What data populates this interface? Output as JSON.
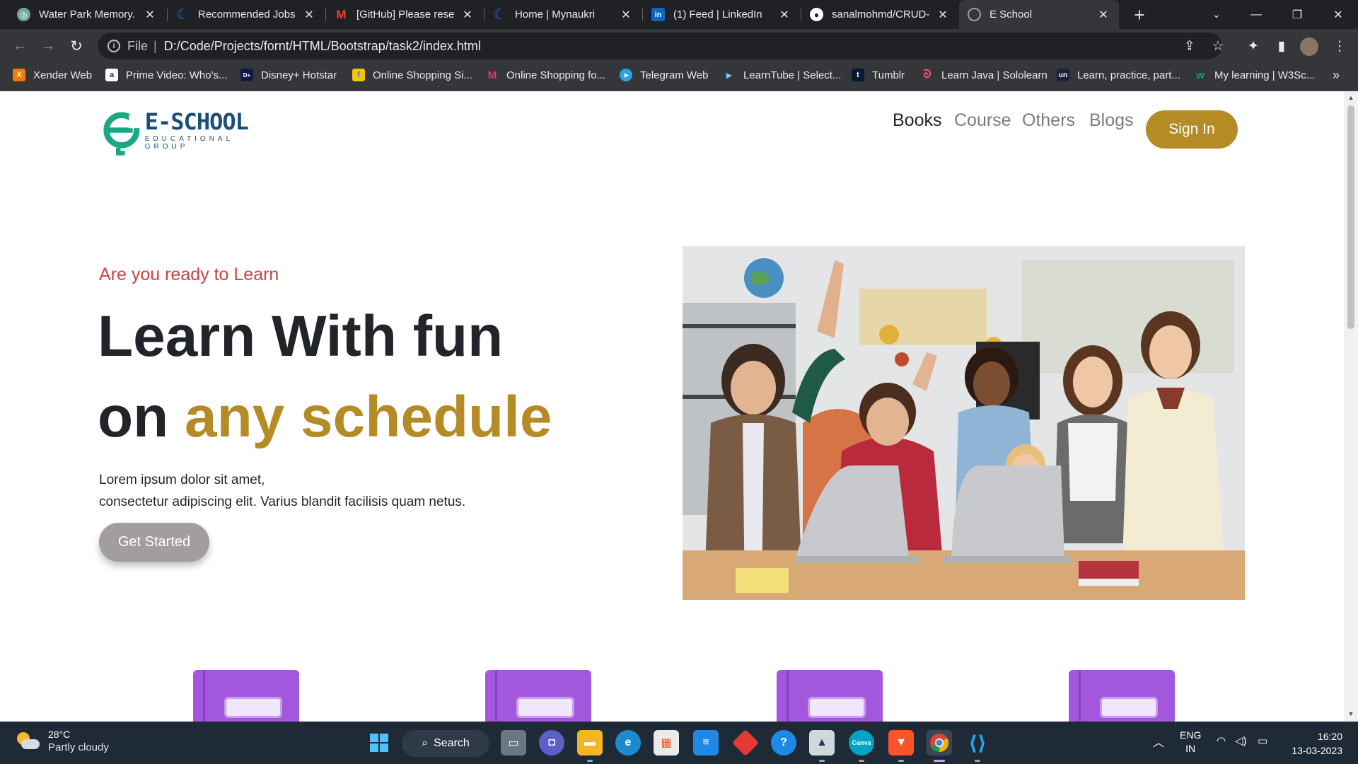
{
  "browser": {
    "tabs": [
      {
        "title": "Water Park Memory.",
        "icon": "chatgpt-icon",
        "color": "#74aa9c"
      },
      {
        "title": "Recommended Jobs |",
        "icon": "naukri-icon",
        "color": "#1d6ef0"
      },
      {
        "title": "[GitHub] Please reset",
        "icon": "gmail-icon",
        "color": "#ea4335"
      },
      {
        "title": "Home | Mynaukri",
        "icon": "naukri-icon",
        "color": "#1d6ef0"
      },
      {
        "title": "(1) Feed | LinkedIn",
        "icon": "linkedin-icon",
        "color": "#0a66c2"
      },
      {
        "title": "sanalmohmd/CRUD-C",
        "icon": "github-icon",
        "color": "#ffffff"
      },
      {
        "title": "E School",
        "icon": "globe-icon",
        "color": "#9aa0a6"
      }
    ],
    "url_scheme": "File",
    "url": "D:/Code/Projects/fornt/HTML/Bootstrap/task2/index.html",
    "bookmarks": [
      {
        "label": "Xender Web",
        "color": "#f57c00"
      },
      {
        "label": "Prime Video: Who's...",
        "color": "#232f3e"
      },
      {
        "label": "Disney+ Hotstar",
        "color": "#0f1a4a"
      },
      {
        "label": "Online Shopping Si...",
        "color": "#f7c600"
      },
      {
        "label": "Online Shopping fo...",
        "color": "#e4317f"
      },
      {
        "label": "Telegram Web",
        "color": "#2aa3df"
      },
      {
        "label": "LearnTube | Select...",
        "color": "#3a5bd9"
      },
      {
        "label": "Tumblr",
        "color": "#001935"
      },
      {
        "label": "Learn Java | Sololearn",
        "color": "#6a3df0"
      },
      {
        "label": "Learn, practice, part...",
        "color": "#1b2240"
      },
      {
        "label": "My learning | W3Sc...",
        "color": "#04aa6d"
      }
    ]
  },
  "site": {
    "logo_main": "E-SCHOOL",
    "logo_sub": "EDUCATIONAL GROUP",
    "nav": [
      "Books",
      "Course",
      "Others",
      "Blogs"
    ],
    "signin": "Sign In",
    "eyebrow": "Are you ready to Learn",
    "headline_line1": "Learn With fun",
    "headline_line2_prefix": "on ",
    "headline_line2_accent": "any schedule",
    "para_line1": "Lorem ipsum dolor sit amet,",
    "para_line2": "consectetur adipiscing elit. Varius blandit facilisis quam netus.",
    "cta": "Get Started",
    "colors": {
      "accent": "#b58b25",
      "eyebrow": "#cf4242",
      "cta": "#a39e9e",
      "book": "#a257dd"
    }
  },
  "taskbar": {
    "temp": "28°C",
    "weather": "Partly cloudy",
    "search": "Search",
    "lang1": "ENG",
    "lang2": "IN",
    "time": "16:20",
    "date": "13-03-2023"
  }
}
